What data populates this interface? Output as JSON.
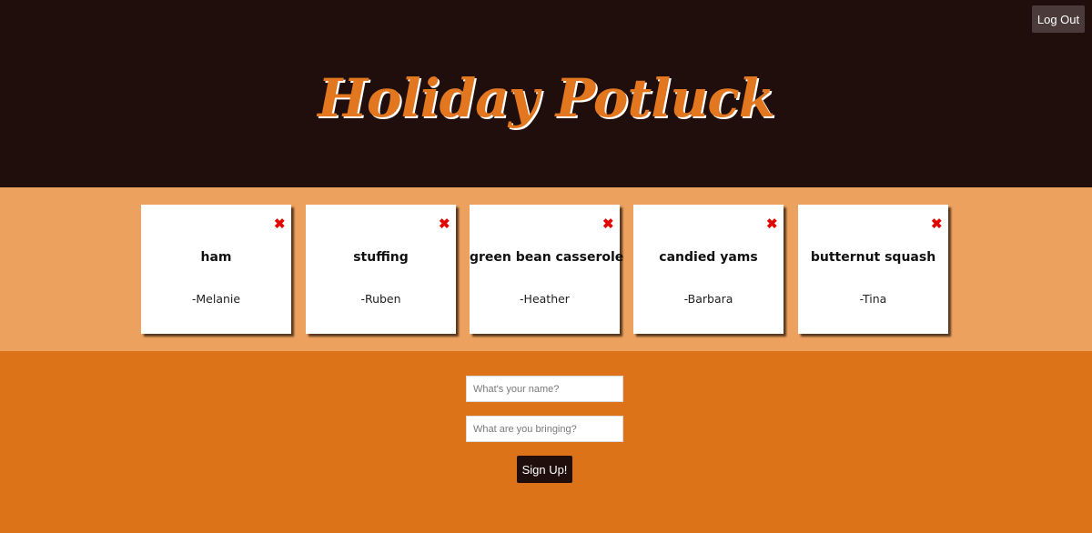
{
  "header": {
    "logout_label": "Log Out",
    "title": "Holiday Potluck"
  },
  "colors": {
    "header_bg": "#200e0d",
    "title": "#e2771f",
    "cards_band_bg": "#eda15e",
    "form_bg": "#dd7319",
    "close_icon": "#e10600"
  },
  "cards": [
    {
      "dish": "ham",
      "person": "-Melanie",
      "close_icon": "close-icon"
    },
    {
      "dish": "stuffing",
      "person": "-Ruben",
      "close_icon": "close-icon"
    },
    {
      "dish": "green bean casserole",
      "person": "-Heather",
      "close_icon": "close-icon"
    },
    {
      "dish": "candied yams",
      "person": "-Barbara",
      "close_icon": "close-icon"
    },
    {
      "dish": "butternut squash",
      "person": "-Tina",
      "close_icon": "close-icon"
    }
  ],
  "form": {
    "name_placeholder": "What's your name?",
    "name_value": "",
    "dish_placeholder": "What are you bringing?",
    "dish_value": "",
    "signup_label": "Sign Up!"
  }
}
